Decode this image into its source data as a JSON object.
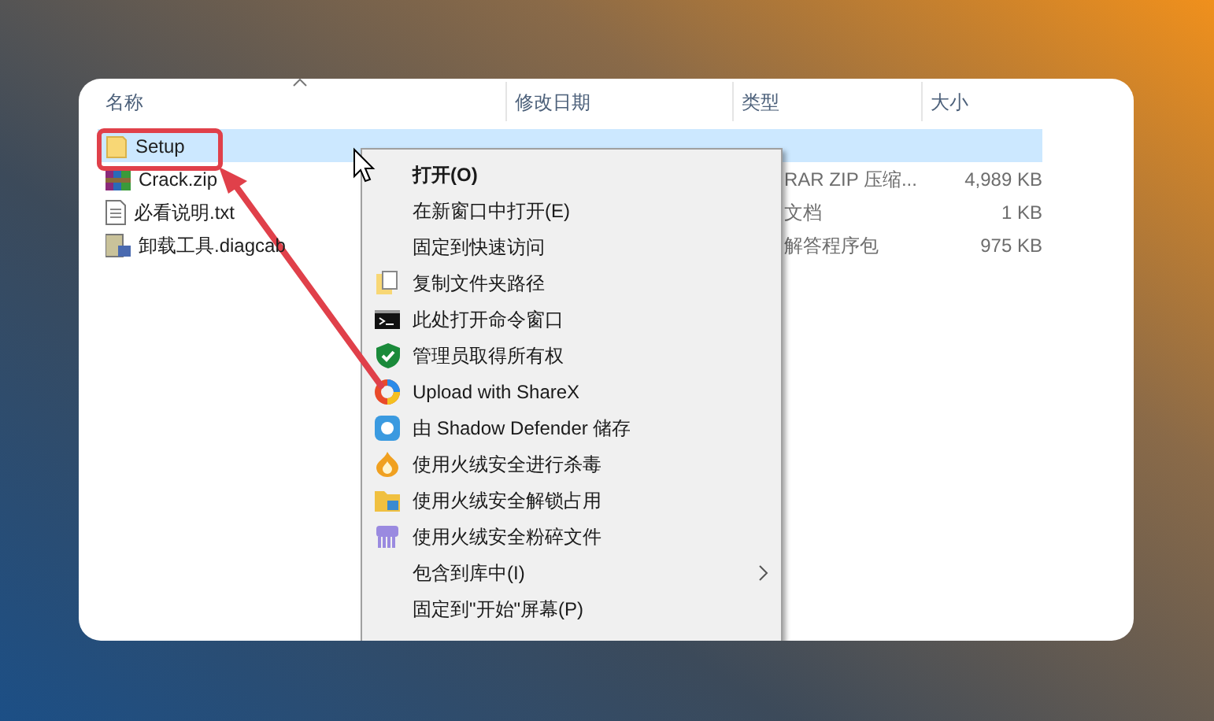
{
  "columns": [
    {
      "label": "名称"
    },
    {
      "label": "修改日期"
    },
    {
      "label": "类型"
    },
    {
      "label": "大小"
    }
  ],
  "files": [
    {
      "name": "Setup",
      "kind": "folder",
      "selected": true
    },
    {
      "name": "Crack.zip",
      "kind": "zip",
      "selected": false,
      "type": "RAR ZIP 压缩...",
      "size": "4,989 KB"
    },
    {
      "name": "必看说明.txt",
      "kind": "text",
      "selected": false,
      "type": "文档",
      "size": "1 KB"
    },
    {
      "name": "卸载工具.diagcab",
      "kind": "diagcab",
      "selected": false,
      "type": "解答程序包",
      "size": "975 KB"
    }
  ],
  "context_menu": [
    {
      "label": "打开(O)",
      "default": true
    },
    {
      "label": "在新窗口中打开(E)",
      "default": false
    },
    {
      "label": "固定到快速访问",
      "default": false
    },
    {
      "label": "复制文件夹路径",
      "default": false,
      "kind": "copy"
    },
    {
      "label": "此处打开命令窗口",
      "default": false,
      "kind": "cmd"
    },
    {
      "label": "管理员取得所有权",
      "default": false,
      "kind": "shield"
    },
    {
      "label": "Upload with ShareX",
      "default": false,
      "kind": "sharex"
    },
    {
      "label": "由 Shadow Defender 储存",
      "default": false,
      "kind": "shadow"
    },
    {
      "label": "使用火绒安全进行杀毒",
      "default": false,
      "kind": "flame"
    },
    {
      "label": "使用火绒安全解锁占用",
      "default": false,
      "kind": "unlock"
    },
    {
      "label": "使用火绒安全粉碎文件",
      "default": false,
      "kind": "shred"
    },
    {
      "label": "包含到库中(I)",
      "default": false,
      "submenu": true
    },
    {
      "label": "固定到\"开始\"屏幕(P)",
      "default": false
    }
  ]
}
